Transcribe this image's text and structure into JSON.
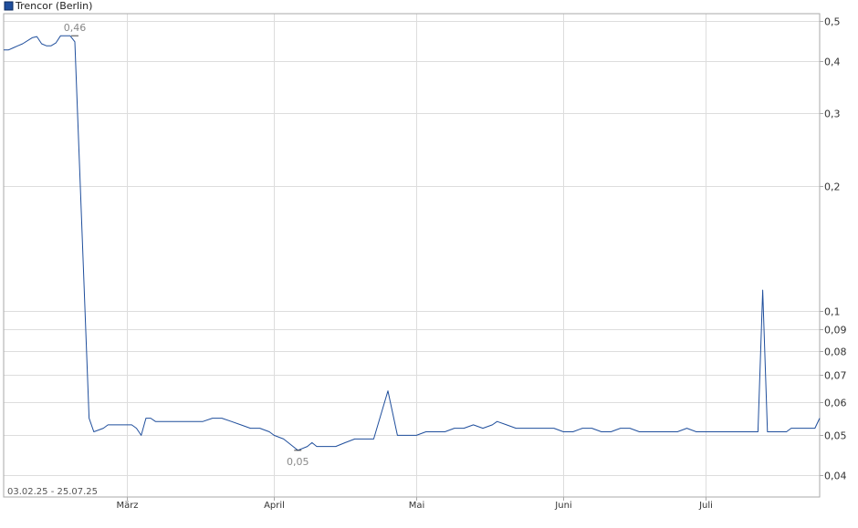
{
  "chart_data": {
    "type": "line",
    "title": "",
    "legend": {
      "label": "Trencor (Berlin)",
      "placement": "top-left"
    },
    "date_range_label": "03.02.25 - 25.07.25",
    "x_tick_labels": [
      "März",
      "April",
      "Mai",
      "Juni",
      "Juli"
    ],
    "x_ticks": [
      "2025-03-01",
      "2025-04-01",
      "2025-05-01",
      "2025-06-01",
      "2025-07-01"
    ],
    "y_scale": "log",
    "ylim": [
      0.0355,
      0.52
    ],
    "y_ticks": [
      0.04,
      0.05,
      0.06,
      0.07,
      0.08,
      0.09,
      0.1,
      0.2,
      0.3,
      0.4,
      0.5
    ],
    "y_tick_labels": [
      "0,04",
      "0,05",
      "0,06",
      "0,07",
      "0,08",
      "0,09",
      "0,1",
      "0,2",
      "0,3",
      "0,4",
      "0,5"
    ],
    "xlim": [
      "2025-02-03",
      "2025-07-25"
    ],
    "grid": true,
    "colors": {
      "line": "#1f4e9c",
      "grid": "#dddddd",
      "axis": "#aaaaaa",
      "marker": "#444444"
    },
    "annotations": [
      {
        "text": "0,46",
        "date": "2025-02-18",
        "value": 0.46,
        "position": "above"
      },
      {
        "text": "0,05",
        "date": "2025-04-06",
        "value": 0.046,
        "position": "below"
      }
    ],
    "series": [
      {
        "name": "Trencor (Berlin)",
        "points": [
          [
            "2025-02-03",
            0.425
          ],
          [
            "2025-02-04",
            0.425
          ],
          [
            "2025-02-05",
            0.43
          ],
          [
            "2025-02-06",
            0.435
          ],
          [
            "2025-02-07",
            0.44
          ],
          [
            "2025-02-09",
            0.455
          ],
          [
            "2025-02-10",
            0.458
          ],
          [
            "2025-02-11",
            0.44
          ],
          [
            "2025-02-12",
            0.435
          ],
          [
            "2025-02-13",
            0.435
          ],
          [
            "2025-02-14",
            0.442
          ],
          [
            "2025-02-15",
            0.46
          ],
          [
            "2025-02-17",
            0.46
          ],
          [
            "2025-02-18",
            0.445
          ],
          [
            "2025-02-21",
            0.055
          ],
          [
            "2025-02-22",
            0.051
          ],
          [
            "2025-02-24",
            0.052
          ],
          [
            "2025-02-25",
            0.053
          ],
          [
            "2025-02-26",
            0.053
          ],
          [
            "2025-02-27",
            0.053
          ],
          [
            "2025-02-28",
            0.053
          ],
          [
            "2025-03-01",
            0.053
          ],
          [
            "2025-03-02",
            0.053
          ],
          [
            "2025-03-03",
            0.052
          ],
          [
            "2025-03-04",
            0.05
          ],
          [
            "2025-03-05",
            0.055
          ],
          [
            "2025-03-06",
            0.055
          ],
          [
            "2025-03-07",
            0.054
          ],
          [
            "2025-03-08",
            0.054
          ],
          [
            "2025-03-09",
            0.054
          ],
          [
            "2025-03-10",
            0.054
          ],
          [
            "2025-03-11",
            0.054
          ],
          [
            "2025-03-13",
            0.054
          ],
          [
            "2025-03-15",
            0.054
          ],
          [
            "2025-03-17",
            0.054
          ],
          [
            "2025-03-19",
            0.055
          ],
          [
            "2025-03-21",
            0.055
          ],
          [
            "2025-03-23",
            0.054
          ],
          [
            "2025-03-25",
            0.053
          ],
          [
            "2025-03-27",
            0.052
          ],
          [
            "2025-03-29",
            0.052
          ],
          [
            "2025-03-31",
            0.051
          ],
          [
            "2025-04-01",
            0.05
          ],
          [
            "2025-04-03",
            0.049
          ],
          [
            "2025-04-05",
            0.047
          ],
          [
            "2025-04-06",
            0.046
          ],
          [
            "2025-04-08",
            0.047
          ],
          [
            "2025-04-09",
            0.048
          ],
          [
            "2025-04-10",
            0.047
          ],
          [
            "2025-04-12",
            0.047
          ],
          [
            "2025-04-14",
            0.047
          ],
          [
            "2025-04-16",
            0.048
          ],
          [
            "2025-04-18",
            0.049
          ],
          [
            "2025-04-20",
            0.049
          ],
          [
            "2025-04-22",
            0.049
          ],
          [
            "2025-04-25",
            0.064
          ],
          [
            "2025-04-27",
            0.05
          ],
          [
            "2025-04-29",
            0.05
          ],
          [
            "2025-05-01",
            0.05
          ],
          [
            "2025-05-03",
            0.051
          ],
          [
            "2025-05-05",
            0.051
          ],
          [
            "2025-05-07",
            0.051
          ],
          [
            "2025-05-09",
            0.052
          ],
          [
            "2025-05-11",
            0.052
          ],
          [
            "2025-05-13",
            0.053
          ],
          [
            "2025-05-15",
            0.052
          ],
          [
            "2025-05-17",
            0.053
          ],
          [
            "2025-05-18",
            0.054
          ],
          [
            "2025-05-20",
            0.053
          ],
          [
            "2025-05-22",
            0.052
          ],
          [
            "2025-05-24",
            0.052
          ],
          [
            "2025-05-26",
            0.052
          ],
          [
            "2025-05-28",
            0.052
          ],
          [
            "2025-05-30",
            0.052
          ],
          [
            "2025-06-01",
            0.051
          ],
          [
            "2025-06-03",
            0.051
          ],
          [
            "2025-06-05",
            0.052
          ],
          [
            "2025-06-07",
            0.052
          ],
          [
            "2025-06-09",
            0.051
          ],
          [
            "2025-06-11",
            0.051
          ],
          [
            "2025-06-13",
            0.052
          ],
          [
            "2025-06-15",
            0.052
          ],
          [
            "2025-06-17",
            0.051
          ],
          [
            "2025-06-19",
            0.051
          ],
          [
            "2025-06-21",
            0.051
          ],
          [
            "2025-06-23",
            0.051
          ],
          [
            "2025-06-25",
            0.051
          ],
          [
            "2025-06-27",
            0.052
          ],
          [
            "2025-06-29",
            0.051
          ],
          [
            "2025-07-01",
            0.051
          ],
          [
            "2025-07-03",
            0.051
          ],
          [
            "2025-07-05",
            0.051
          ],
          [
            "2025-07-07",
            0.051
          ],
          [
            "2025-07-09",
            0.051
          ],
          [
            "2025-07-11",
            0.051
          ],
          [
            "2025-07-12",
            0.051
          ],
          [
            "2025-07-13",
            0.112
          ],
          [
            "2025-07-14",
            0.051
          ],
          [
            "2025-07-16",
            0.051
          ],
          [
            "2025-07-18",
            0.051
          ],
          [
            "2025-07-19",
            0.052
          ],
          [
            "2025-07-21",
            0.052
          ],
          [
            "2025-07-23",
            0.052
          ],
          [
            "2025-07-24",
            0.052
          ],
          [
            "2025-07-25",
            0.055
          ]
        ]
      }
    ]
  }
}
